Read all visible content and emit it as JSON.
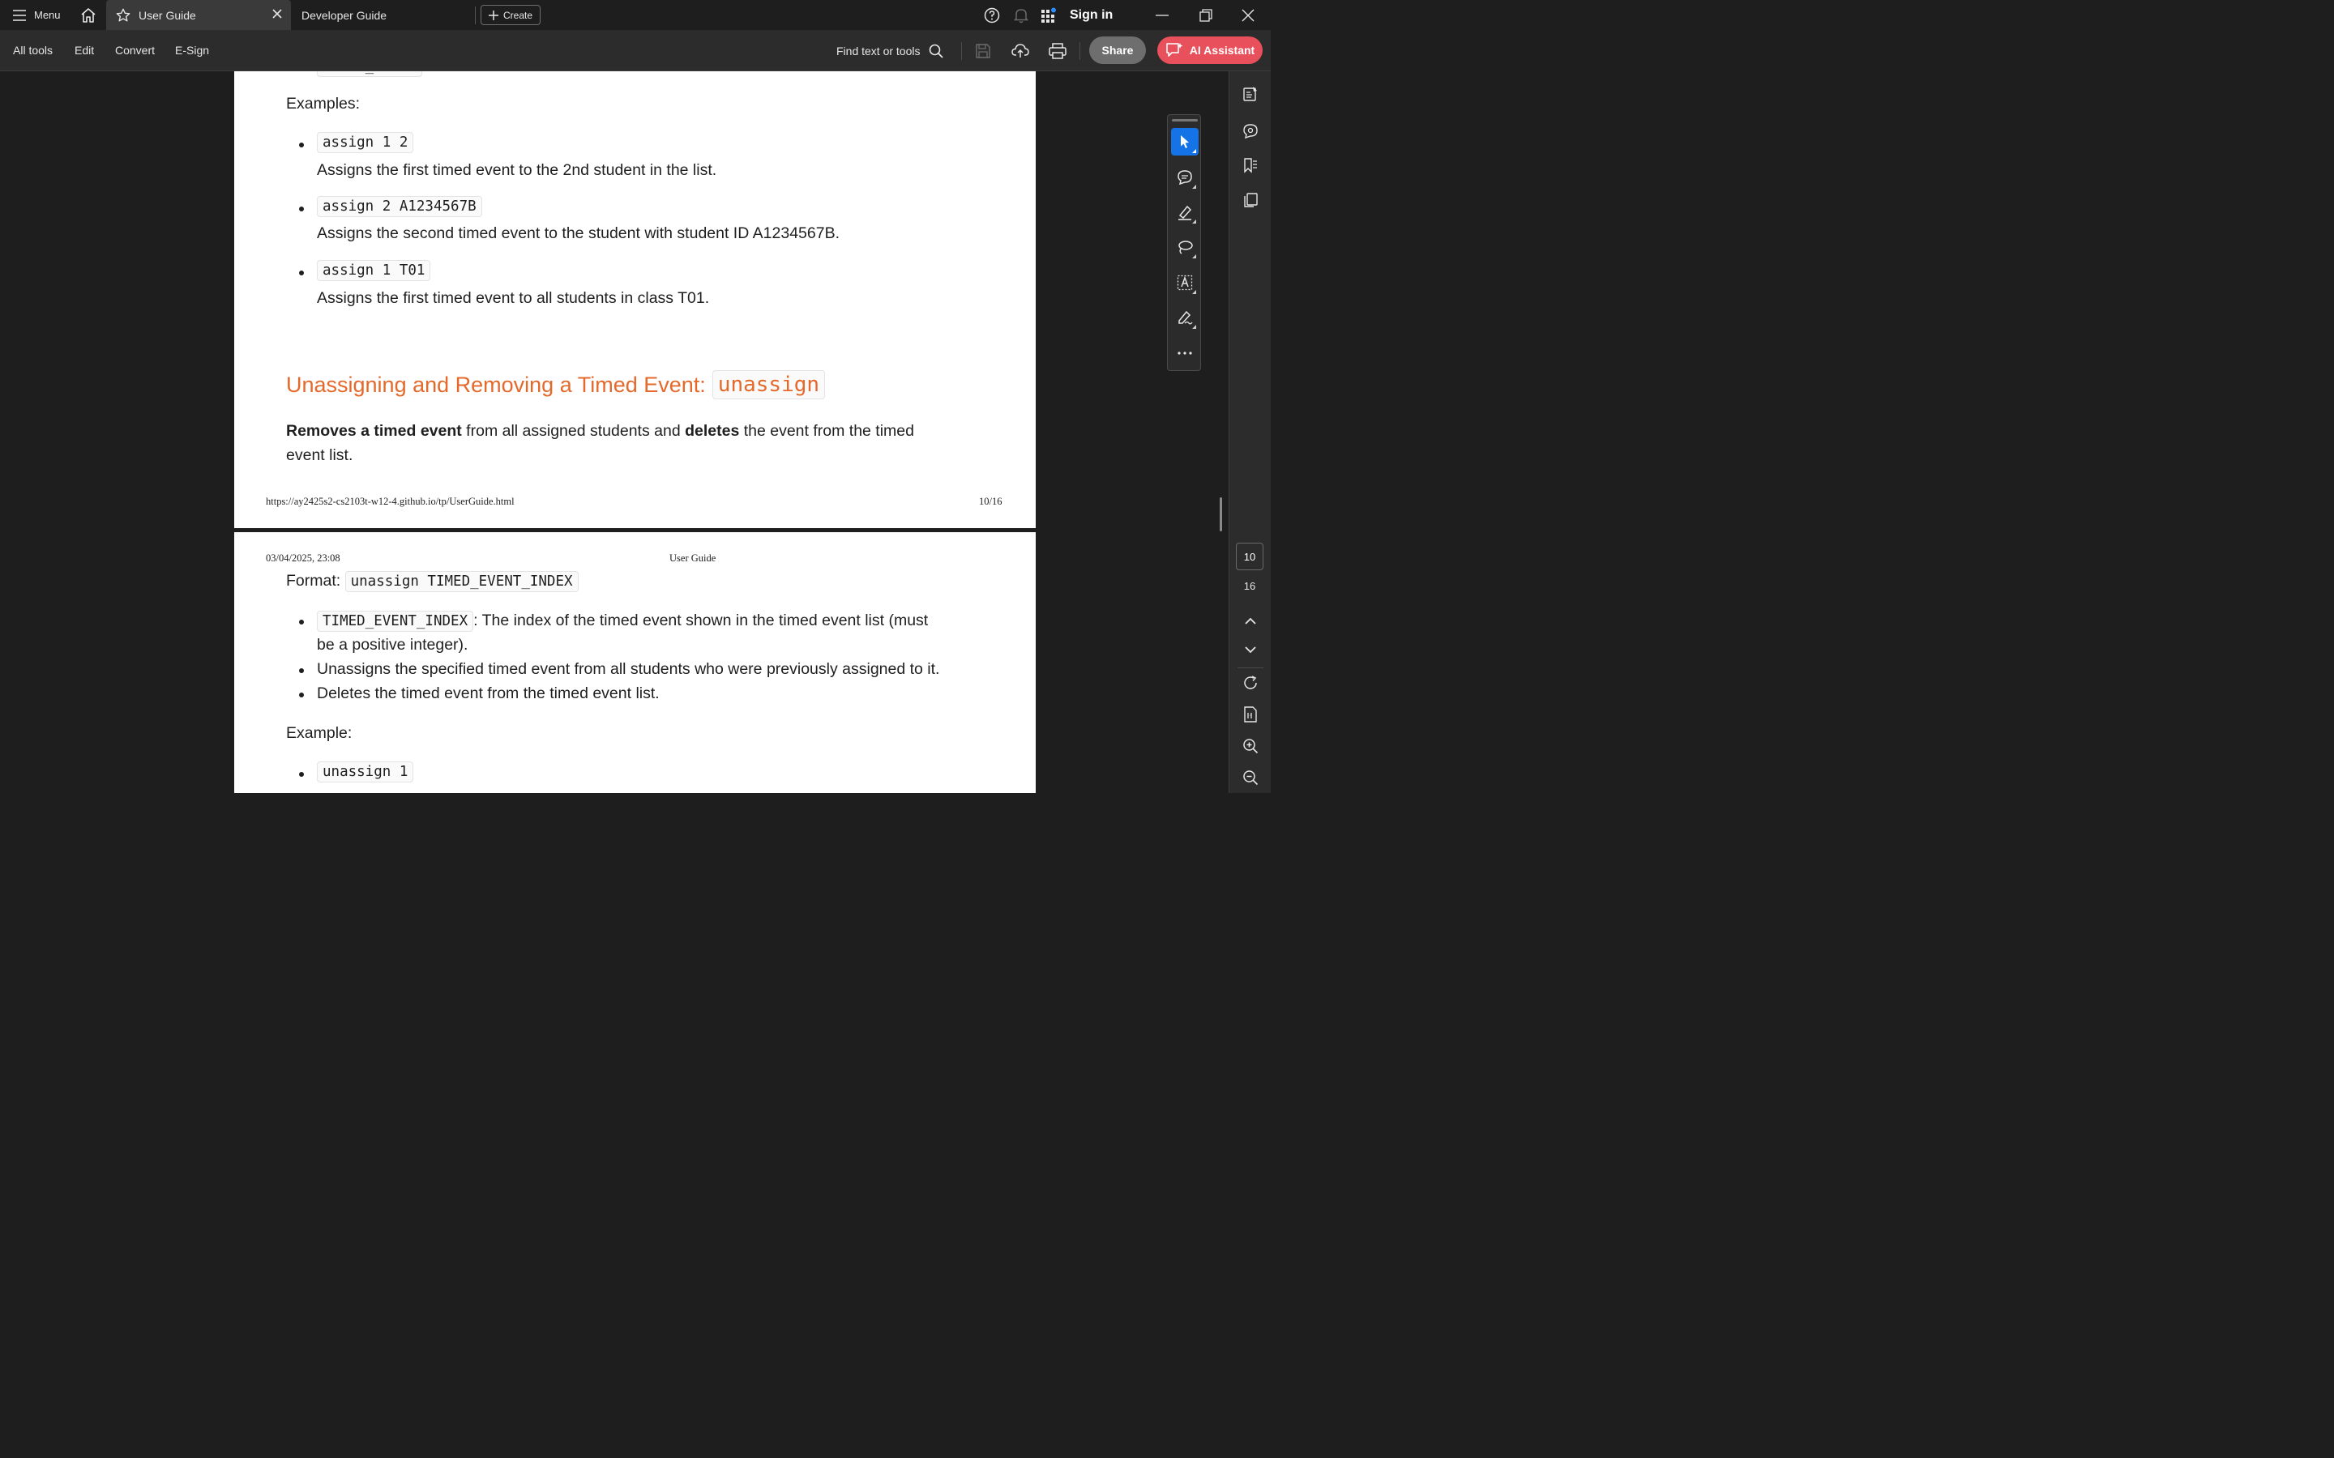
{
  "tabbar": {
    "menu_label": "Menu",
    "tabs": [
      {
        "label": "User Guide",
        "active": true
      },
      {
        "label": "Developer Guide",
        "active": false
      }
    ],
    "create_label": "Create",
    "sign_in_label": "Sign in"
  },
  "toolbar": {
    "menus": [
      "All tools",
      "Edit",
      "Convert",
      "E-Sign"
    ],
    "find_label": "Find text or tools",
    "share_label": "Share",
    "ai_label": "AI Assistant"
  },
  "page1": {
    "examples_label": "Examples:",
    "examples": [
      {
        "code": "assign 1 2",
        "desc": "Assigns the first timed event to the 2nd student in the list."
      },
      {
        "code": "assign 2 A1234567B",
        "desc": "Assigns the second timed event to the student with student ID A1234567B."
      },
      {
        "code": "assign 1 T01",
        "desc": "Assigns the first timed event to all students in class T01."
      }
    ],
    "heading_text": "Unassigning and Removing a Timed Event:",
    "heading_code": "unassign",
    "desc_bold1": "Removes a timed event",
    "desc_mid": " from all assigned students and ",
    "desc_bold2": "deletes",
    "desc_end": " the event from the timed",
    "desc_line2": "event list.",
    "footer_url": "https://ay2425s2-cs2103t-w12-4.github.io/tp/UserGuide.html",
    "footer_page": "10/16"
  },
  "page2": {
    "header_date": "03/04/2025, 23:08",
    "header_title": "User Guide",
    "format_label": "Format:",
    "format_code": "unassign TIMED_EVENT_INDEX",
    "param_code": "TIMED_EVENT_INDEX",
    "param_desc": ": The index of the timed event shown in the timed event list (must",
    "param_desc_line2": "be a positive integer).",
    "bullet2": "Unassigns the specified timed event from all students who were previously assigned to it.",
    "bullet3": "Deletes the timed event from the timed event list.",
    "example_label": "Example:",
    "example_code": "unassign 1"
  },
  "page_nav": {
    "current_page": "10",
    "total_pages": "16"
  },
  "colors": {
    "accent": "#1473e6",
    "heading": "#e4692a",
    "ai_button": "#e8505b"
  }
}
